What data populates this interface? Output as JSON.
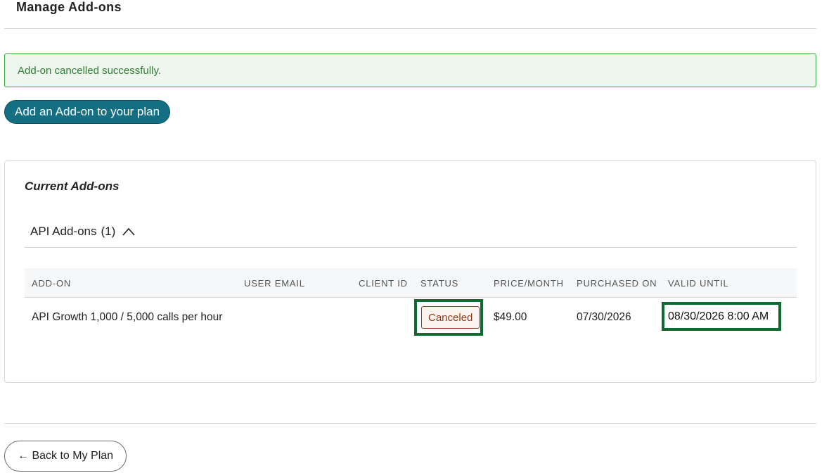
{
  "page": {
    "title": "Manage Add-ons"
  },
  "alert": {
    "message": "Add-on cancelled successfully."
  },
  "actions": {
    "add_addon_label": "Add an Add-on to your plan",
    "back_label": "← Back to My Plan"
  },
  "card": {
    "title": "Current Add-ons",
    "section": {
      "label": "API Add-ons",
      "count": "(1)",
      "icon": "chevron-up-icon",
      "expanded": true
    },
    "table": {
      "headers": [
        "ADD-ON",
        "USER EMAIL",
        "CLIENT ID",
        "STATUS",
        "PRICE/MONTH",
        "PURCHASED ON",
        "VALID UNTIL"
      ],
      "rows": [
        {
          "addon": "API Growth 1,000 / 5,000 calls per hour",
          "user_email": "",
          "client_id": "",
          "status": "Canceled",
          "price": "$49.00",
          "purchased_on": "07/30/2026",
          "valid_until": "08/30/2026 8:00 AM"
        }
      ]
    }
  },
  "colors": {
    "primary_button": "#146f83",
    "success_border": "#3aa13f",
    "success_text": "#2e7d32",
    "highlight_border": "#0d6b30",
    "status_canceled": "#8a3b1b"
  }
}
